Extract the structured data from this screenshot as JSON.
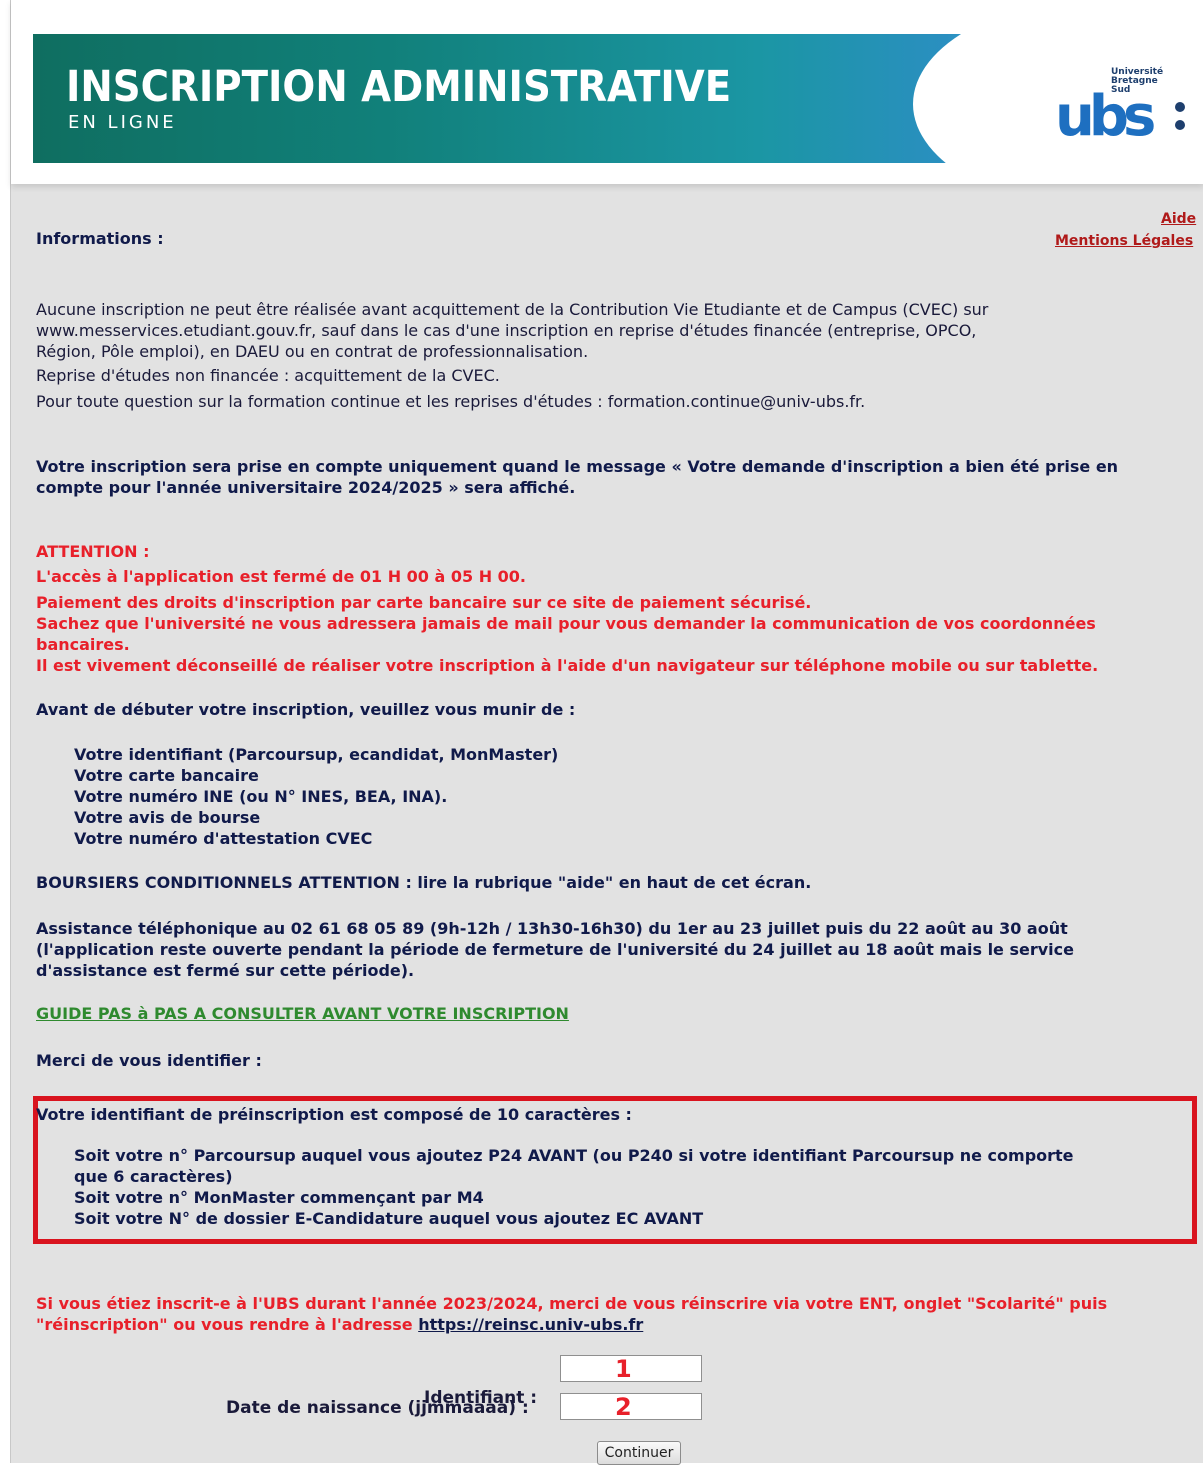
{
  "banner": {
    "title": "INSCRIPTION ADMINISTRATIVE",
    "subtitle": "EN LIGNE",
    "logo_text": "ubs",
    "logo_small": "Université Bretagne Sud"
  },
  "links": {
    "aide": "Aide",
    "mentions": "Mentions Légales"
  },
  "informations_label": "Informations :",
  "paragraphs": {
    "cvec_1": "Aucune inscription ne peut être réalisée avant acquittement de la Contribution Vie Etudiante et de Campus (CVEC) sur",
    "cvec_2": "www.messervices.etudiant.gouv.fr, sauf dans le cas d'une inscription en reprise d'études financée (entreprise, OPCO,",
    "cvec_3": "Région, Pôle emploi), en DAEU ou en contrat de professionnalisation.",
    "reprise": "Reprise d'études non financée : acquittement de la CVEC.",
    "question": "Pour toute question sur la formation continue et les reprises d'études : formation.continue@univ-ubs.fr.",
    "prise_1": "Votre inscription sera prise en compte uniquement quand le message « Votre demande d'inscription a bien été prise en",
    "prise_2": "compte pour l'année universitaire 2024/2025 » sera affiché."
  },
  "attention": {
    "title": "ATTENTION :",
    "line1": "L'accès à l'application est fermé de 01 H 00 à 05 H 00.",
    "line2": "Paiement des droits d'inscription par carte bancaire sur ce site de paiement sécurisé.",
    "line3a": "Sachez que l'université ne vous adressera jamais de mail pour vous demander la communication de vos coordonnées",
    "line3b": "bancaires.",
    "line4": "Il est vivement déconseillé de réaliser votre inscription à l'aide d'un navigateur sur téléphone mobile ou sur tablette."
  },
  "avant": {
    "title": "Avant de débuter votre inscription, veuillez vous munir de :",
    "items": [
      "Votre identifiant (Parcoursup, ecandidat, MonMaster)",
      "Votre carte bancaire",
      "Votre numéro INE (ou N° INES, BEA, INA).",
      "Votre avis de bourse",
      "Votre numéro d'attestation CVEC"
    ]
  },
  "boursiers": "BOURSIERS CONDITIONNELS ATTENTION : lire la rubrique \"aide\" en haut de cet écran.",
  "assistance": {
    "line1": "Assistance téléphonique au 02 61 68 05 89 (9h-12h / 13h30-16h30) du 1er au 23 juillet puis du 22 août au 30 août",
    "line2": "(l'application reste ouverte pendant la période de fermeture de l'université du 24 juillet au 18 août mais le service",
    "line3": "d'assistance est fermé sur cette période)."
  },
  "guide_link": "GUIDE PAS à PAS A CONSULTER AVANT VOTRE INSCRIPTION",
  "merci": "Merci de vous identifier :",
  "identifiant_box": {
    "title": "Votre identifiant de préinscription est composé de 10 caractères :",
    "item1a": "Soit votre n° Parcoursup auquel vous ajoutez P24 AVANT (ou P240 si votre identifiant Parcoursup ne comporte",
    "item1b": "que 6 caractères)",
    "item2": "Soit votre n° MonMaster commençant par M4",
    "item3": "Soit votre N° de dossier E-Candidature auquel vous ajoutez EC AVANT"
  },
  "reinscription": {
    "line1": "Si vous étiez inscrit-e à l'UBS durant l'année 2023/2024, merci de vous réinscrire via votre ENT, onglet \"Scolarité\" puis",
    "line2_prefix": "\"réinscription\" ou vous rendre à l'adresse ",
    "link": "https://reinsc.univ-ubs.fr"
  },
  "form": {
    "identifiant_label": "Identifiant :",
    "identifiant_value": "",
    "identifiant_marker": "1",
    "date_label": "Date de naissance (jjmmaaaa) :",
    "date_value": "",
    "date_marker": "2",
    "submit": "Continuer"
  },
  "colors": {
    "alert_red": "#e8202a",
    "box_red": "#d9141f",
    "link_green": "#2f8a2f",
    "background": "#e2e2e2"
  }
}
